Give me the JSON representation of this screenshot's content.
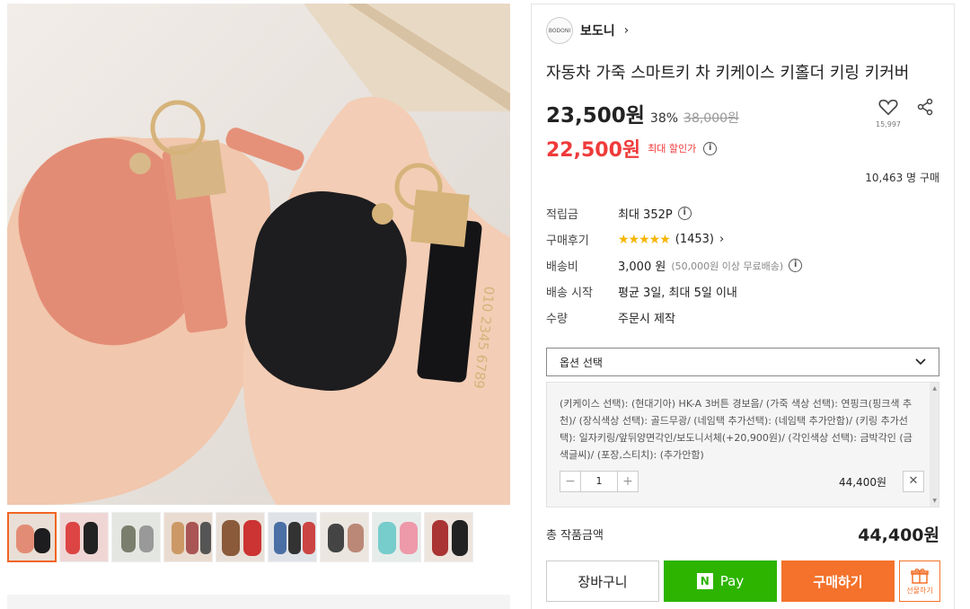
{
  "store": {
    "name": "보도니",
    "logo_text": "BODONI"
  },
  "product": {
    "title": "자동차 가죽 스마트키 차 키케이스 키홀더 키링 키커버",
    "price": "23,500원",
    "discount_pct": "38%",
    "original_price": "38,000원",
    "sale_price": "22,500원",
    "sale_note": "최대 할인가",
    "likes": "15,997",
    "buyers": "10,463 명 구매"
  },
  "specs": {
    "points_label": "적립금",
    "points_value": "최대 352P",
    "review_label": "구매후기",
    "review_stars": "★★★★★",
    "review_count": "(1453)",
    "shipping_label": "배송비",
    "shipping_value": "3,000 원",
    "shipping_note": "(50,000원 이상 무료배송)",
    "ship_start_label": "배송 시작",
    "ship_start_value": "평균 3일, 최대 5일 이내",
    "qty_label": "수량",
    "qty_value": "주문시 제작"
  },
  "option": {
    "select_label": "옵션 선택",
    "selected_text": "(키케이스 선택): (현대기아) HK-A 3버튼 경보음/ (가죽 색상 선택): 연핑크(핑크색 추천)/ (장식색상 선택): 골드무광/ (네임택 추가선택): (네임택 추가안함)/ (키링 추가선택): 일자키링/앞뒤양면각인/보도니서체(+20,900원)/ (각인색상 선택): 금박각인 (금색글씨)/ (포장,스티치): (추가안함)",
    "quantity": "1",
    "price": "44,400원",
    "minus": "−",
    "plus": "+",
    "remove": "✕"
  },
  "total": {
    "label": "총 작품금액",
    "value": "44,400원"
  },
  "buttons": {
    "cart": "장바구니",
    "npay_n": "N",
    "npay": "Pay",
    "buy": "구매하기",
    "gift": "선물하기"
  },
  "icons": {
    "chevron": "›",
    "info": "i",
    "dropdown": "⌄"
  },
  "colors": {
    "accent": "#f4722b",
    "sale": "#f03a3a",
    "npay": "#2db400",
    "stars": "#f7b500"
  }
}
